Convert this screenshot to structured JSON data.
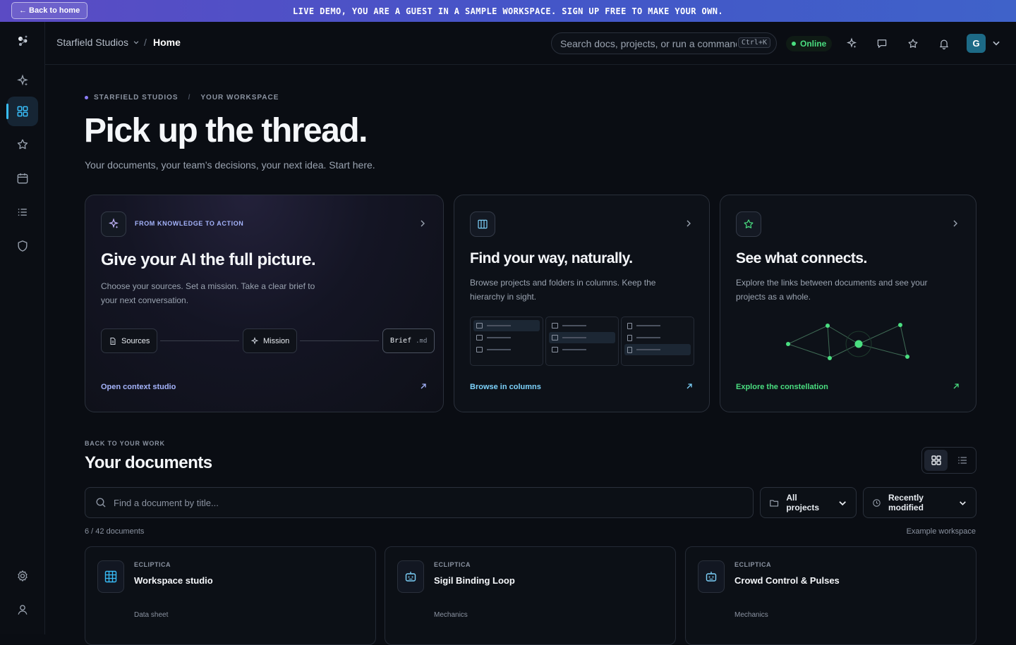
{
  "banner": {
    "back_label": "← Back to home",
    "message": "LIVE DEMO, YOU ARE A GUEST IN A SAMPLE WORKSPACE. SIGN UP FREE TO MAKE YOUR OWN."
  },
  "topbar": {
    "workspace": "Starfield Studios",
    "separator": "/",
    "current_page": "Home",
    "search_placeholder": "Search docs, projects, or run a command",
    "search_shortcut": "Ctrl+K",
    "status": "Online",
    "avatar_initial": "G"
  },
  "colors": {
    "accent_cyan": "#38bdf8",
    "accent_green": "#4ade80",
    "accent_purple": "#a5b4fc",
    "link_blue": "#7dd3fc",
    "link_green": "#4ade80"
  },
  "hero": {
    "eyebrow_workspace": "STARFIELD STUDIOS",
    "eyebrow_separator": "/",
    "eyebrow_section": "YOUR WORKSPACE",
    "title": "Pick up the thread.",
    "subtitle": "Your documents, your team’s decisions, your next idea. Start here."
  },
  "cards": {
    "ai": {
      "tag": "FROM KNOWLEDGE TO ACTION",
      "title": "Give your AI the full picture.",
      "desc_line1": "Choose your sources. Set a mission. Take a clear brief to",
      "desc_line2": "your next conversation.",
      "pill_sources": "Sources",
      "pill_mission": "Mission",
      "pill_brief": "Brief",
      "pill_brief_ext": ".md",
      "link": "Open context studio"
    },
    "columns": {
      "title": "Find your way, naturally.",
      "desc_line1": "Browse projects and folders in columns. Keep the",
      "desc_line2": "hierarchy in sight.",
      "link": "Browse in columns"
    },
    "constellation": {
      "title": "See what connects.",
      "desc_line1": "Explore the links between documents and see your",
      "desc_line2": "projects as a whole.",
      "link": "Explore the constellation"
    }
  },
  "documents": {
    "eyebrow": "BACK TO YOUR WORK",
    "title": "Your documents",
    "search_placeholder": "Find a document by title...",
    "filter_projects": "All projects",
    "filter_sort": "Recently modified",
    "count": "6 / 42 documents",
    "example_note": "Example workspace",
    "items": [
      {
        "project": "ECLIPTICA",
        "title": "Workspace studio",
        "type": "Data sheet",
        "icon": "grid-icon"
      },
      {
        "project": "ECLIPTICA",
        "title": "Sigil Binding Loop",
        "type": "Mechanics",
        "icon": "robot-icon"
      },
      {
        "project": "ECLIPTICA",
        "title": "Crowd Control & Pulses",
        "type": "Mechanics",
        "icon": "robot-icon"
      }
    ]
  }
}
